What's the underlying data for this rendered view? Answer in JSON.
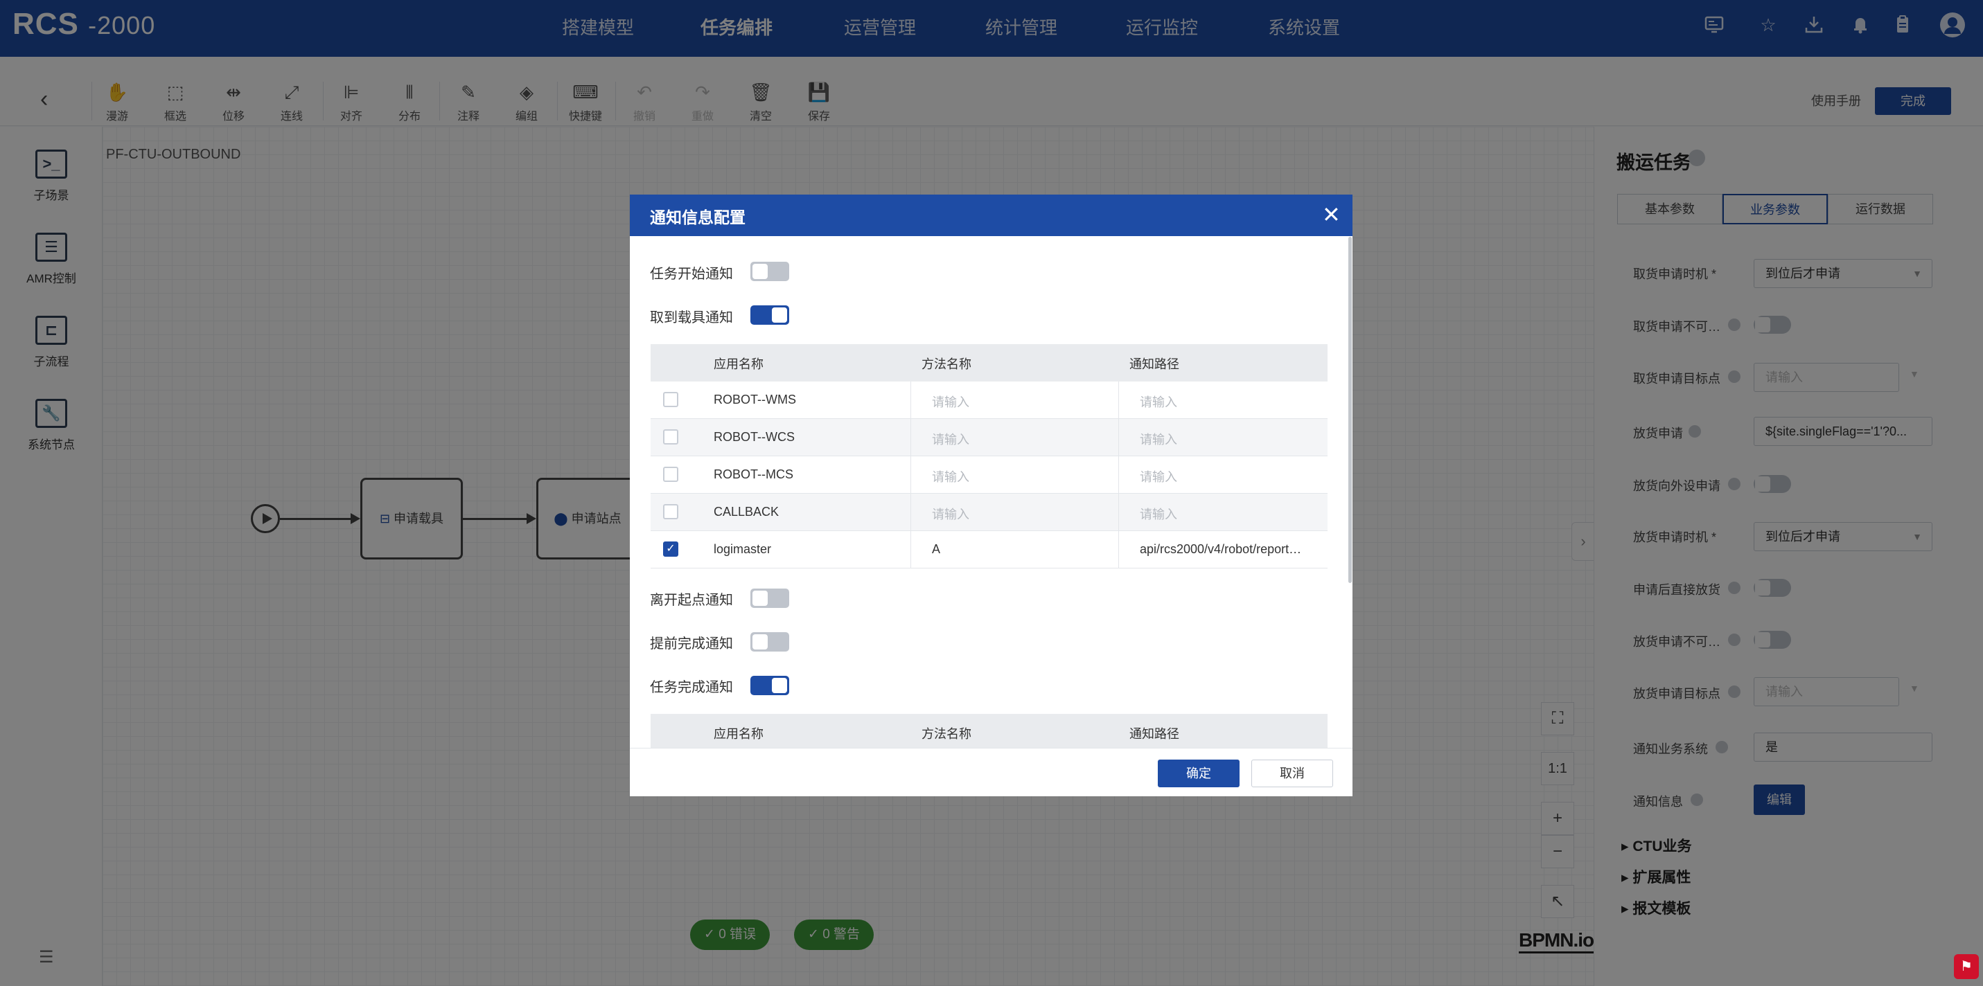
{
  "app": {
    "logo_main": "RCS",
    "logo_sub": "-2000"
  },
  "nav": {
    "items": [
      "搭建模型",
      "任务编排",
      "运营管理",
      "统计管理",
      "运行监控",
      "系统设置"
    ],
    "active": "任务编排"
  },
  "top_icons": [
    "monitor-icon",
    "star-icon",
    "download-icon",
    "bell-icon",
    "clipboard-icon",
    "avatar-icon"
  ],
  "toolbar": {
    "tools": [
      "漫游",
      "框选",
      "位移",
      "连线",
      "对齐",
      "分布",
      "注释",
      "编组",
      "快捷键",
      "撤销",
      "重做",
      "清空",
      "保存"
    ],
    "help_link": "使用手册",
    "done_label": "完成"
  },
  "left_panel": {
    "items": [
      "子场景",
      "AMR控制",
      "子流程",
      "系统节点"
    ]
  },
  "canvas": {
    "process_name": "PF-CTU-OUTBOUND",
    "nodes": [
      "申请载具",
      "申请站点"
    ],
    "zoom_controls": [
      "fit-icon",
      "1:1",
      "+",
      "−",
      "collapse-icon"
    ],
    "status": {
      "errors": "0 错误",
      "warnings": "0 警告"
    },
    "brand": "BPMN.io"
  },
  "right_panel": {
    "title": "搬运任务",
    "tabs": [
      "基本参数",
      "业务参数",
      "运行数据"
    ],
    "active_tab": "业务参数",
    "fields": [
      {
        "label": "取货申请时机",
        "required": true,
        "type": "select",
        "value": "到位后才申请"
      },
      {
        "label": "取货申请不可…",
        "type": "toggle"
      },
      {
        "label": "取货申请目标点",
        "type": "input",
        "placeholder": "请输入"
      },
      {
        "label": "放货申请",
        "type": "text",
        "value": "${site.singleFlag=='1'?0..."
      },
      {
        "label": "放货向外设申请",
        "type": "toggle"
      },
      {
        "label": "放货申请时机",
        "required": true,
        "type": "select",
        "value": "到位后才申请"
      },
      {
        "label": "申请后直接放货",
        "type": "toggle"
      },
      {
        "label": "放货申请不可…",
        "type": "toggle"
      },
      {
        "label": "放货申请目标点",
        "type": "input",
        "placeholder": "请输入"
      },
      {
        "label": "通知业务系统",
        "type": "text",
        "value": "是"
      },
      {
        "label": "通知信息",
        "type": "button",
        "value": "编辑"
      }
    ],
    "groups": [
      "CTU业务",
      "扩展属性",
      "报文模板"
    ]
  },
  "modal": {
    "title": "通知信息配置",
    "toggles": [
      {
        "label": "任务开始通知",
        "on": false
      },
      {
        "label": "取到载具通知",
        "on": true
      },
      {
        "label": "离开起点通知",
        "on": false
      },
      {
        "label": "提前完成通知",
        "on": false
      },
      {
        "label": "任务完成通知",
        "on": true
      }
    ],
    "table_headers": [
      "应用名称",
      "方法名称",
      "通知路径"
    ],
    "rows": [
      {
        "checked": false,
        "app": "ROBOT--WMS",
        "method": "",
        "path": ""
      },
      {
        "checked": false,
        "app": "ROBOT--WCS",
        "method": "",
        "path": ""
      },
      {
        "checked": false,
        "app": "ROBOT--MCS",
        "method": "",
        "path": ""
      },
      {
        "checked": false,
        "app": "CALLBACK",
        "method": "",
        "path": ""
      },
      {
        "checked": true,
        "app": "logimaster",
        "method": "A",
        "path": "api/rcs2000/v4/robot/report…"
      }
    ],
    "placeholder": "请输入",
    "ok_label": "确定",
    "cancel_label": "取消"
  }
}
